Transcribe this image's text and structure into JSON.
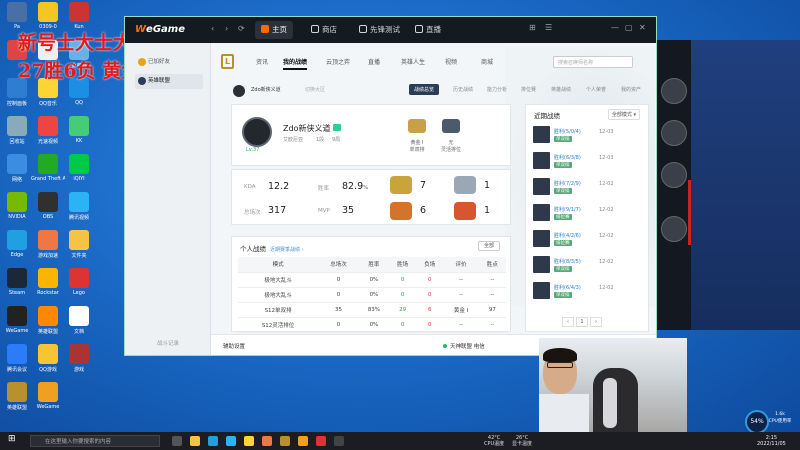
{
  "overlay": {
    "line1": "新号士大士大师",
    "line2": "27胜6负 黄金1"
  },
  "desktop_icons": [
    {
      "label": "Pa",
      "color": "#4a6fa5"
    },
    {
      "label": "0309-0",
      "color": "#f3c623"
    },
    {
      "label": "Kun",
      "color": "#c33"
    },
    {
      "label": "",
      "color": "#d44"
    },
    {
      "label": "",
      "color": "#eee"
    },
    {
      "label": "此电脑",
      "color": "#6ab0e8"
    },
    {
      "label": "控制面板",
      "color": "#2d7dd2"
    },
    {
      "label": "QQ音乐",
      "color": "#fcd535"
    },
    {
      "label": "QQ",
      "color": "#1a8fe3"
    },
    {
      "label": "回收站",
      "color": "#8ab"
    },
    {
      "label": "光速视频",
      "color": "#e44"
    },
    {
      "label": "KK",
      "color": "#4c7"
    },
    {
      "label": "网络",
      "color": "#3a8de0"
    },
    {
      "label": "Grand Theft Auto V",
      "color": "#2a2"
    },
    {
      "label": "iQIYI",
      "color": "#00c94a"
    },
    {
      "label": "NVIDIA",
      "color": "#76b900"
    },
    {
      "label": "OBS",
      "color": "#303030"
    },
    {
      "label": "腾讯视频",
      "color": "#2bb4f5"
    },
    {
      "label": "Edge",
      "color": "#1fa0e0"
    },
    {
      "label": "游戏加速",
      "color": "#e74"
    },
    {
      "label": "文件夹",
      "color": "#f6c444"
    },
    {
      "label": "Steam",
      "color": "#1b2838"
    },
    {
      "label": "Rockstar",
      "color": "#fbb400"
    },
    {
      "label": "Lego",
      "color": "#d33"
    },
    {
      "label": "WeGame",
      "color": "#222"
    },
    {
      "label": "英雄联盟",
      "color": "#ff8800"
    },
    {
      "label": "文档",
      "color": "#fff"
    },
    {
      "label": "腾讯会议",
      "color": "#2b7cf6"
    },
    {
      "label": "QQ游戏",
      "color": "#f7c531"
    },
    {
      "label": "游戏",
      "color": "#a33"
    },
    {
      "label": "英雄联盟",
      "color": "#b8912e"
    },
    {
      "label": "WeGame",
      "color": "#f0a020"
    }
  ],
  "app": {
    "logo_prefix": "W",
    "logo_rest": "eGame",
    "nav": [
      "‹",
      "›",
      "⟳"
    ],
    "tabs": [
      {
        "label": "主页",
        "active": true
      },
      {
        "label": "商店",
        "active": false
      },
      {
        "label": "先锋测试",
        "active": false
      },
      {
        "label": "直播",
        "active": false
      }
    ],
    "window_controls": [
      "⊞",
      "☰",
      "—",
      "▢",
      "✕"
    ]
  },
  "sidebar": {
    "items": [
      {
        "label": "已加好友",
        "active": false
      },
      {
        "label": "英雄联盟",
        "active": true
      }
    ],
    "footer": "战斗记录"
  },
  "game_tabs": [
    {
      "label": "资讯",
      "active": false
    },
    {
      "label": "我的战绩",
      "active": true
    },
    {
      "label": "云顶之弈",
      "active": false
    },
    {
      "label": "直播",
      "active": false
    },
    {
      "label": "英雄人生",
      "active": false
    },
    {
      "label": "视频",
      "active": false
    },
    {
      "label": "商城",
      "active": false
    }
  ],
  "search_placeholder": "搜索召唤师名称",
  "subbar": {
    "account": "Zdo新侠义道",
    "switch": "切换大区",
    "tabs": [
      {
        "label": "战绩总览",
        "active": true
      },
      {
        "label": "历史战绩",
        "active": false
      },
      {
        "label": "能力分析",
        "active": false
      },
      {
        "label": "排位赛",
        "active": false
      },
      {
        "label": "英雄战绩",
        "active": false
      },
      {
        "label": "个人荣誉",
        "active": false
      },
      {
        "label": "我的资产",
        "active": false
      }
    ]
  },
  "profile": {
    "name": "Zdo新侠义道",
    "level": "Lv.37",
    "region": "艾欧尼亚",
    "rank_text": "1段",
    "count": "9局",
    "badges": [
      {
        "label": "黄金 I",
        "sub": "单双排"
      },
      {
        "label": "无",
        "sub": "灵活排位"
      }
    ]
  },
  "stats": [
    {
      "label": "KDA",
      "value": "12.2",
      "unit": ""
    },
    {
      "label": "胜率",
      "value": "82.9",
      "unit": "%"
    },
    {
      "label": "总场次",
      "value": "317",
      "unit": ""
    },
    {
      "label": "MVP",
      "value": "35",
      "unit": ""
    }
  ],
  "categories": [
    {
      "count": "7",
      "color": "#c9a43a"
    },
    {
      "count": "1",
      "color": "#9aa8b5"
    },
    {
      "count": "6",
      "color": "#d4742a"
    },
    {
      "count": "1",
      "color": "#d8562f"
    }
  ],
  "table": {
    "title": "个人战绩",
    "link": "近期赛季战绩 ›",
    "select": "全部",
    "headers": [
      "模式",
      "总场次",
      "胜率",
      "胜场",
      "负场",
      "评价",
      "胜点"
    ],
    "rows": [
      [
        "极地大乱斗",
        "0",
        "0%",
        "0",
        "0",
        "--",
        "--"
      ],
      [
        "极地大乱斗",
        "0",
        "0%",
        "0",
        "0",
        "--",
        "--"
      ],
      [
        "S12单双排",
        "35",
        "83%",
        "29",
        "6",
        "黄金 I",
        "97"
      ],
      [
        "S12灵活排位",
        "0",
        "0%",
        "0",
        "0",
        "--",
        "--"
      ]
    ]
  },
  "recent": {
    "title": "近期战绩",
    "select": "全部模式 ▾",
    "matches": [
      {
        "result": "胜利(5/0/4)",
        "mode": "单双排",
        "date": "12-03"
      },
      {
        "result": "胜利(6/3/8)",
        "mode": "单双排",
        "date": "12-03"
      },
      {
        "result": "胜利(7/2/9)",
        "mode": "单双排",
        "date": "12-02"
      },
      {
        "result": "胜利(9/1/7)",
        "mode": "排位赛",
        "date": "12-02"
      },
      {
        "result": "胜利(4/2/6)",
        "mode": "排位赛",
        "date": "12-02"
      },
      {
        "result": "胜利(8/3/5)",
        "mode": "单双排",
        "date": "12-02"
      },
      {
        "result": "胜利(6/4/3)",
        "mode": "单双排",
        "date": "12-02"
      }
    ],
    "pager": [
      "‹",
      "1",
      "›"
    ]
  },
  "bottombar": {
    "left": "辅助设置",
    "middle": "天神联盟 电信",
    "right": "⌃"
  },
  "gauge": {
    "value": "54%",
    "line1": "1.6k",
    "line2": "CPU使用率"
  },
  "taskbar": {
    "search": "在这里输入你要搜索的内容",
    "weather1": "42°C",
    "weather1_sub": "CPU温度",
    "weather2": "26°C",
    "weather2_sub": "显卡温度",
    "time": "2:15",
    "date": "2022/11/05"
  }
}
